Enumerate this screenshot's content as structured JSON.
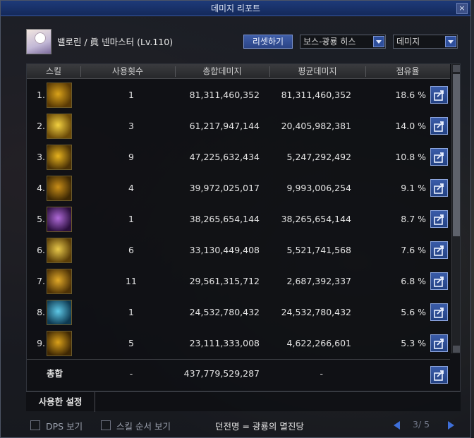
{
  "window": {
    "title": "데미지 리포트",
    "close": "×"
  },
  "header": {
    "character": "밸로린 / 眞 넨마스터 (Lv.110)",
    "reset_label": "리셋하기",
    "target_select": "보스-광룡 히스",
    "mode_select": "데미지"
  },
  "columns": [
    "스킬",
    "사용횟수",
    "총합데미지",
    "평균데미지",
    "점유율"
  ],
  "rows": [
    {
      "idx": "1.",
      "count": "1",
      "total": "81,311,460,352",
      "avg": "81,311,460,352",
      "pct": "18.6 %",
      "icon": "skill-icon-1",
      "c1": "#d9a21a",
      "c2": "#5a3a05"
    },
    {
      "idx": "2.",
      "count": "3",
      "total": "61,217,947,144",
      "avg": "20,405,982,381",
      "pct": "14.0 %",
      "icon": "skill-icon-2",
      "c1": "#f2d040",
      "c2": "#6b4a08"
    },
    {
      "idx": "3.",
      "count": "9",
      "total": "47,225,632,434",
      "avg": "5,247,292,492",
      "pct": "10.8 %",
      "icon": "skill-icon-3",
      "c1": "#e6b21e",
      "c2": "#4a3106"
    },
    {
      "idx": "4.",
      "count": "4",
      "total": "39,972,025,017",
      "avg": "9,993,006,254",
      "pct": "9.1 %",
      "icon": "skill-icon-4",
      "c1": "#c98e18",
      "c2": "#3d2804"
    },
    {
      "idx": "5.",
      "count": "1",
      "total": "38,265,654,144",
      "avg": "38,265,654,144",
      "pct": "8.7 %",
      "icon": "skill-icon-5",
      "c1": "#b06ad8",
      "c2": "#2a0f3d"
    },
    {
      "idx": "6.",
      "count": "6",
      "total": "33,130,449,408",
      "avg": "5,521,741,568",
      "pct": "7.6 %",
      "icon": "skill-icon-6",
      "c1": "#e8c84a",
      "c2": "#5a3e08"
    },
    {
      "idx": "7.",
      "count": "11",
      "total": "29,561,315,712",
      "avg": "2,687,392,337",
      "pct": "6.8 %",
      "icon": "skill-icon-7",
      "c1": "#e0a828",
      "c2": "#4e3206"
    },
    {
      "idx": "8.",
      "count": "1",
      "total": "24,532,780,432",
      "avg": "24,532,780,432",
      "pct": "5.6 %",
      "icon": "skill-icon-8",
      "c1": "#5ec8e6",
      "c2": "#0e3a52"
    },
    {
      "idx": "9.",
      "count": "5",
      "total": "23,111,333,008",
      "avg": "4,622,266,601",
      "pct": "5.3 %",
      "icon": "skill-icon-9",
      "c1": "#d9a01a",
      "c2": "#3f2804"
    }
  ],
  "totals": {
    "label": "총합",
    "count": "-",
    "total": "437,779,529,287",
    "avg": "-"
  },
  "settings": {
    "label": "사용한 설정"
  },
  "footer": {
    "dps_label": "DPS 보기",
    "order_label": "스킬 순서 보기",
    "dungeon": "던전명 = 광룡의 멸진당",
    "page": "3/ 5"
  },
  "colors": {
    "accent": "#2b4486",
    "title_bar": "#1e3a79"
  }
}
